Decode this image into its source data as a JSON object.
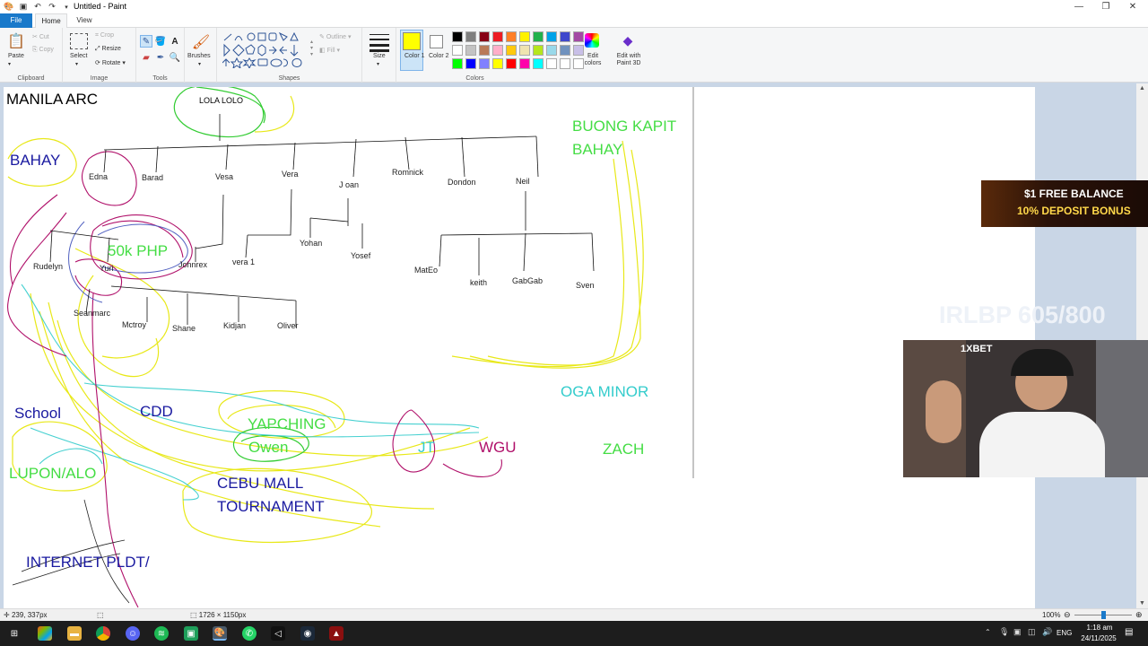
{
  "app": {
    "title": "Untitled - Paint",
    "tabs": [
      "File",
      "Home",
      "View"
    ]
  },
  "ribbon": {
    "clipboard": {
      "label": "Clipboard",
      "paste": "Paste",
      "cut": "Cut",
      "copy": "Copy"
    },
    "image": {
      "label": "Image",
      "select": "Select",
      "crop": "Crop",
      "resize": "Resize",
      "rotate": "Rotate"
    },
    "tools": {
      "label": "Tools"
    },
    "brushes": {
      "label": "Brushes"
    },
    "shapes": {
      "label": "Shapes",
      "outline": "Outline",
      "fill": "Fill"
    },
    "size": {
      "label": "Size"
    },
    "colors": {
      "label": "Colors",
      "color1": "Color 1",
      "color2": "Color 2",
      "edit_colors": "Edit colors",
      "paint3d": "Edit with Paint 3D",
      "color1_value": "#ffff00",
      "color2_value": "#ffffff",
      "palette_row1": [
        "#000000",
        "#7f7f7f",
        "#880015",
        "#ed1c24",
        "#ff7f27",
        "#fff200",
        "#22b14c",
        "#00a2e8",
        "#3f48cc",
        "#a349a4"
      ],
      "palette_row2": [
        "#ffffff",
        "#c3c3c3",
        "#b97a57",
        "#ffaec9",
        "#ffc90e",
        "#efe4b0",
        "#b5e61d",
        "#99d9ea",
        "#7092be",
        "#c8bfe7"
      ],
      "palette_row3": [
        "#00ff00",
        "#0000ff",
        "#8080ff",
        "#ffff00",
        "#ff0000",
        "#ff00aa",
        "#00ffff",
        "#ffffff",
        "#ffffff",
        "#ffffff"
      ]
    }
  },
  "drawing": {
    "heading": "MANILA ARC",
    "root": "LOLA LOLO",
    "children": [
      "Edna",
      "Barad",
      "Vesa",
      "Vera",
      "J oan",
      "Romnick",
      "Dondon",
      "Neil"
    ],
    "grandchildren": [
      "Rudelyn",
      "Yuri",
      "Johnrex",
      "vera 1",
      "Yohan",
      "Yosef",
      "MatEo",
      "keith",
      "GabGab",
      "Sven"
    ],
    "great_grandchildren": [
      "Seanmarc",
      "Mctroy",
      "Shane",
      "Kidjan",
      "Oliver"
    ],
    "labels": {
      "bahay": "BAHAY",
      "php": "50k PHP",
      "buong_kapit_1": "BUONG KAPIT",
      "buong_kapit_2": "BAHAY",
      "school": "School",
      "cdd": "CDD",
      "yapching": "YAPCHING",
      "owen": "Owen",
      "jt": "JT",
      "wgu": "WGU",
      "oga_minor": "OGA MINOR",
      "zach": "ZACH",
      "lupon": "LUPON/ALO",
      "cebu_1": "CEBU MALL",
      "cebu_2": "TOURNAMENT",
      "internet": "INTERNET PLDT/"
    }
  },
  "overlay": {
    "promo_line1": "$1 FREE BALANCE",
    "promo_line2": "10% DEPOSIT BONUS",
    "counter": "IRLBP 605/800",
    "webcam_brand": "1XBET"
  },
  "status": {
    "cursor": "239, 337px",
    "canvas_size": "1726 × 1150px",
    "zoom": "100%"
  },
  "taskbar": {
    "language": "ENG",
    "time": "1:18 am",
    "date": "24/11/2025"
  }
}
